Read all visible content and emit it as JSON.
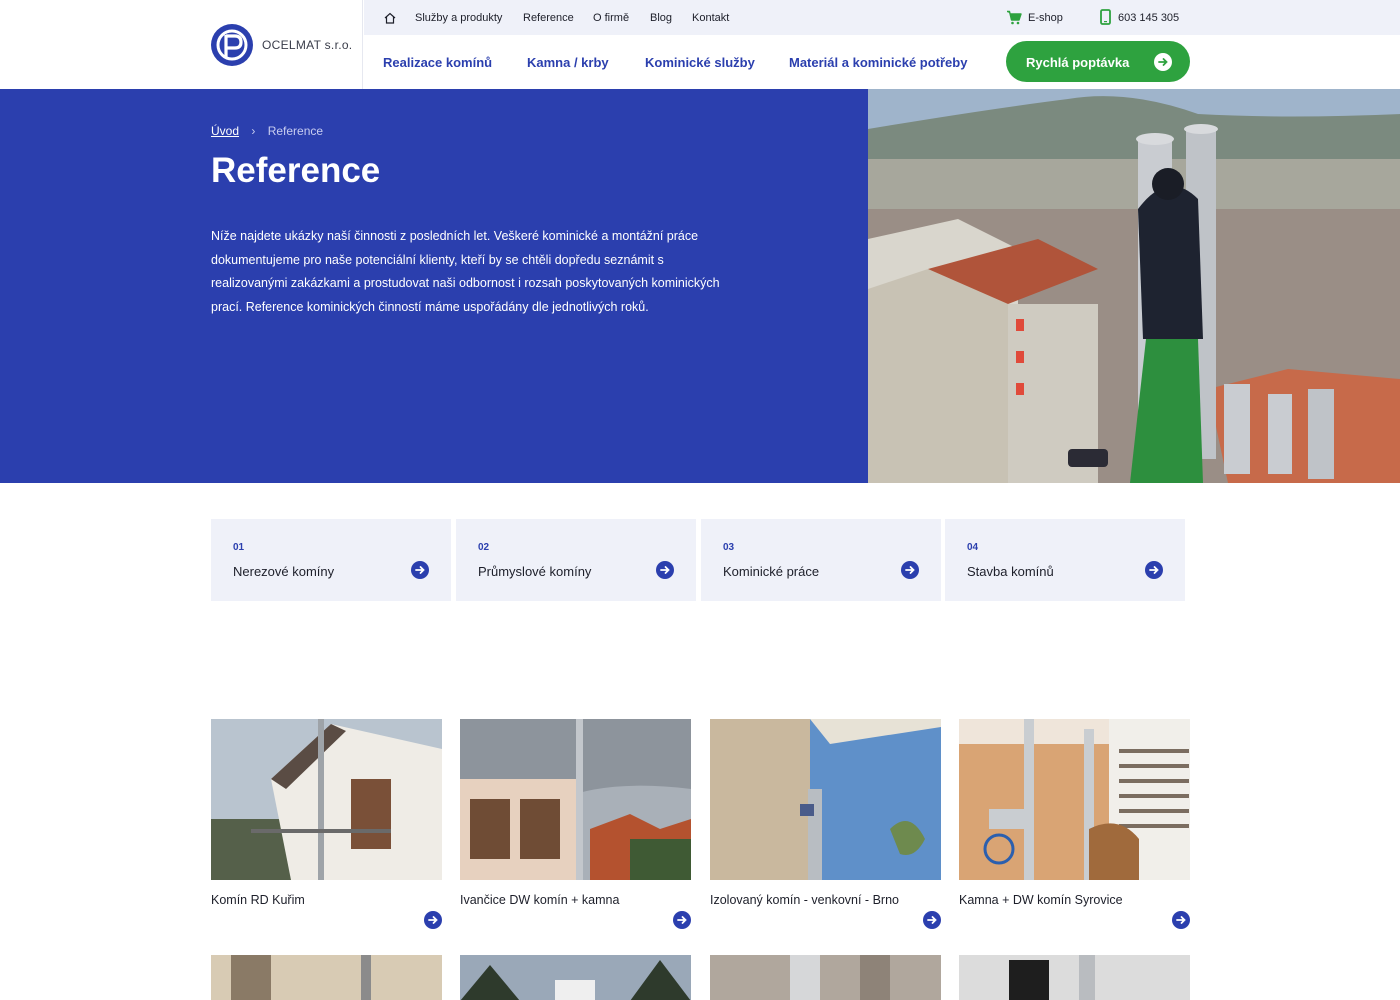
{
  "brand": {
    "name": "OCELMAT s.r.o.",
    "accent": "#2b3fae",
    "green": "#2ea23f"
  },
  "topbar": {
    "links": [
      "Služby a produkty",
      "Reference",
      "O firmě",
      "Blog",
      "Kontakt"
    ],
    "eshop": "E-shop",
    "phone": "603 145 305"
  },
  "mainnav": {
    "items": [
      "Realizace komínů",
      "Kamna / krby",
      "Kominické služby",
      "Materiál a kominické potřeby"
    ],
    "cta": "Rychlá poptávka"
  },
  "hero": {
    "breadcrumb": {
      "home": "Úvod",
      "separator": "›",
      "current": "Reference"
    },
    "title": "Reference",
    "text": "Níže najdete ukázky naší činnosti z posledních let. Veškeré kominické a montážní práce dokumentujeme pro naše potenciální klienty, kteří by se chtěli dopředu seznámit s realizovanými zakázkami a prostudovat naši odbornost i rozsah poskytovaných kominických prací. Reference kominických činností máme uspořádány dle jednotlivých roků."
  },
  "categories": [
    {
      "num": "01",
      "name": "Nerezové komíny"
    },
    {
      "num": "02",
      "name": "Průmyslové komíny"
    },
    {
      "num": "03",
      "name": "Kominické práce"
    },
    {
      "num": "04",
      "name": "Stavba komínů"
    }
  ],
  "references": [
    {
      "caption": "Komín RD Kuřim"
    },
    {
      "caption": "Ivančice DW komín + kamna"
    },
    {
      "caption": "Izolovaný komín - venkovní - Brno"
    },
    {
      "caption": "Kamna + DW komín Syrovice"
    }
  ]
}
